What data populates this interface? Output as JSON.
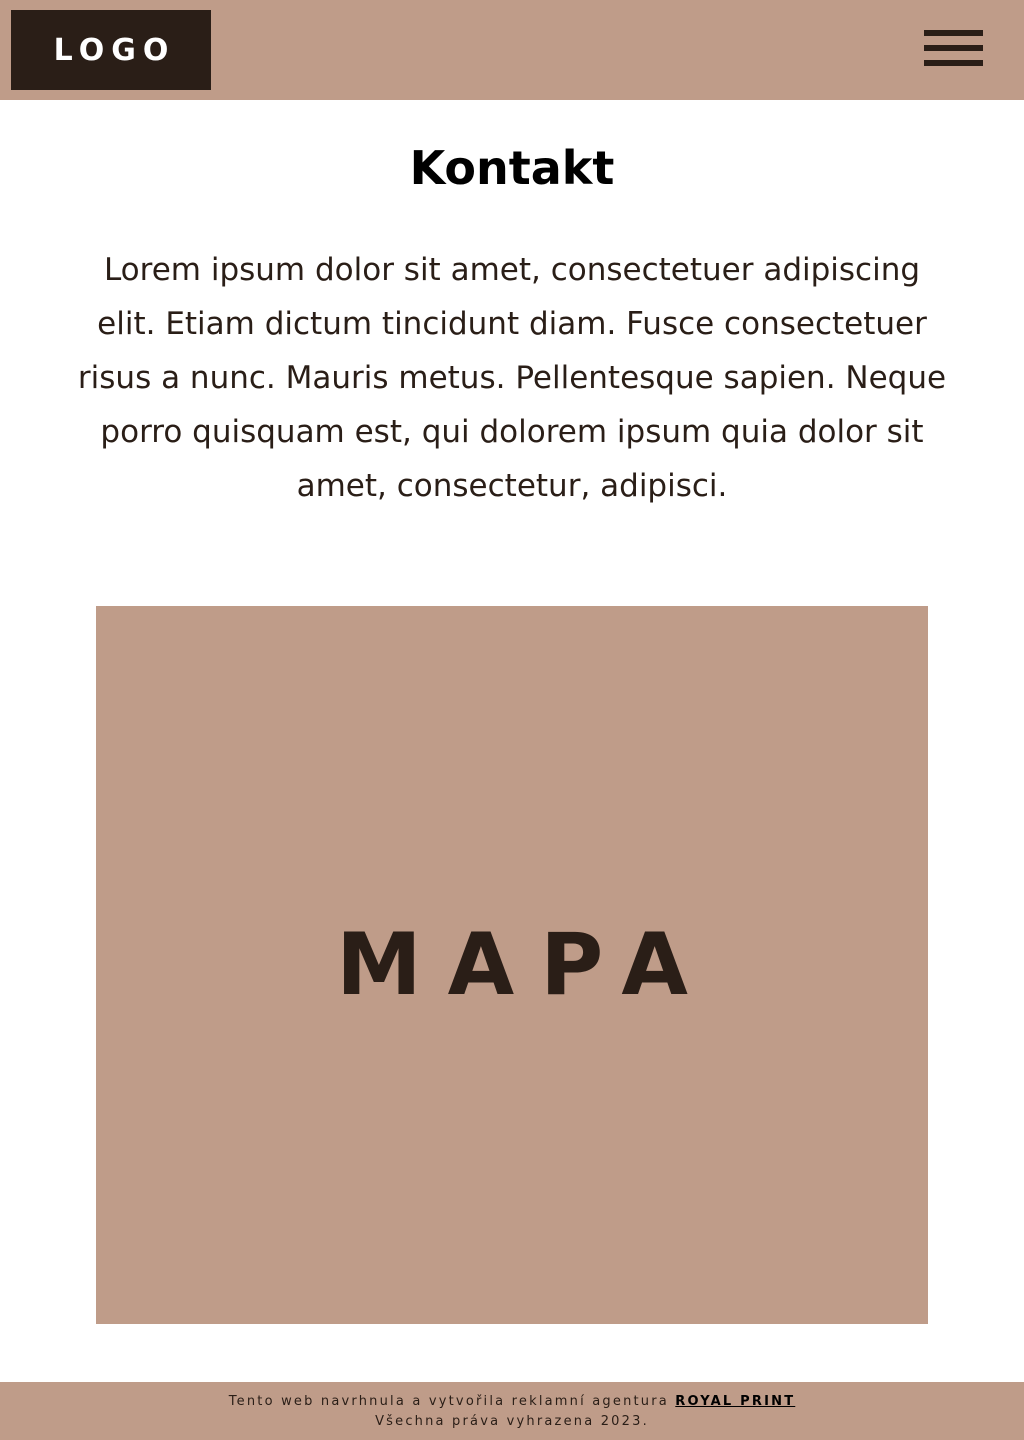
{
  "colors": {
    "accent": "#bf9c89",
    "dark": "#2a1e17",
    "background": "#ffffff"
  },
  "header": {
    "logo_text": "LOGO",
    "menu_icon": "hamburger-menu-icon"
  },
  "main": {
    "title": "Kontakt",
    "intro": "Lorem ipsum dolor sit amet, consectetuer adipiscing elit. Etiam dictum tincidunt diam. Fusce consectetuer risus a nunc. Mauris metus. Pellentesque sapien. Neque porro quisquam est, qui dolorem ipsum quia dolor sit amet, consectetur, adipisci.",
    "map_label": "MAPA"
  },
  "footer": {
    "credit_text": "Tento web navrhnula a vytvořila reklamní agentura",
    "agency_link": "ROYAL PRINT",
    "rights": "Všechna práva vyhrazena 2023."
  }
}
